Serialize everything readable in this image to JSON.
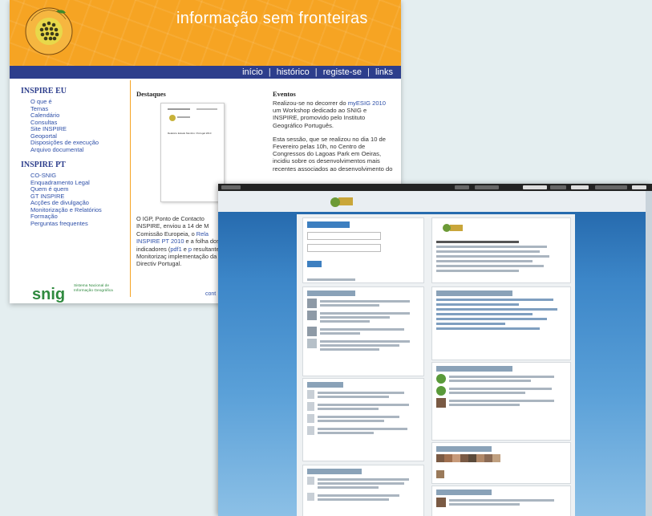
{
  "site": {
    "tagline": "informação sem fronteiras",
    "logo_arc_text": "INSPIRE - Infraestrutura de Dados Espaciais na Europa",
    "nav": [
      "início",
      "histórico",
      "registe-se",
      "links"
    ],
    "nav_separator": "|",
    "inspire_eu": {
      "title": "INSPIRE EU",
      "items": [
        "O que é",
        "Temas",
        "Calendário",
        "Consultas",
        "Site INSPIRE",
        "Geoportal",
        "Disposições de execução",
        "Arquivo documental"
      ]
    },
    "inspire_pt": {
      "title": "INSPIRE PT",
      "items": [
        "CO-SNIG",
        "Enquadramento Legal",
        "Quem é quem",
        "GT INSPIRE",
        "Acções de divulgação",
        "Monitorização e Relatórios",
        "Formação",
        "Perguntas frequentes"
      ]
    },
    "snig": {
      "word": "snig",
      "subtitle": "Sistema Nacional de Informação Geográfica"
    },
    "destaques_title": "Destaques",
    "doc_title": "Relatório Estado Membro: Portugal 2010",
    "eventos_title": "Eventos",
    "eventos_p1_a": "Realizou-se no decorrer do ",
    "eventos_p1_link": "myESIG 2010",
    "eventos_p1_b": " um Workshop dedicado ao SNIG e INSPIRE, promovido pelo Instituto Geográfico Português.",
    "eventos_p2": "Esta sessão, que se realizou no dia 10 de Fevereiro pelas 10h, no Centro de Congressos do Lagoas Park em Oeiras, incidiu sobre os desenvolvimentos mais recentes associados ao desenvolvimento do",
    "bottom_a": "O IGP, Ponto de Contacto INSPIRE, enviou a 14 de M Comissão Europeia, o ",
    "bottom_link1": "Rela",
    "bottom_b": " ",
    "bottom_link2": "INSPIRE PT 2010",
    "bottom_c": " e a folha dos indicadores (",
    "bottom_link3": "pdf1",
    "bottom_d": " e ",
    "bottom_link4": "p",
    "bottom_e": " resultante da Monitorizaç implementação da Directiv Portugal.",
    "cont": "cont"
  },
  "colors": {
    "banner_orange": "#f6a423",
    "nav_blue": "#2d3e8c",
    "link_blue": "#2d4fa8",
    "snig_green": "#2f8a3f",
    "forum_blue": "#3c86c8"
  }
}
